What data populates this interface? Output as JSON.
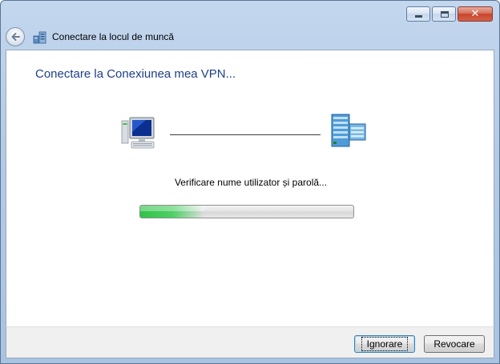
{
  "window": {
    "title": "Conectare la locul de muncă",
    "close_glyph": "✕"
  },
  "main": {
    "heading": "Conectare la Conexiunea mea VPN...",
    "status_text": "Verificare nume utilizator și parolă...",
    "progress_fraction": 0.3
  },
  "icons": {
    "back": "back-arrow-icon",
    "wizard": "network-connection-icon",
    "computer": "computer-icon",
    "server": "server-icon"
  },
  "footer": {
    "ignore_label": "Ignorare",
    "cancel_label": "Revocare"
  },
  "colors": {
    "heading": "#1e3f87",
    "progress": "#31c24a",
    "frame": "#b4cbe6"
  }
}
